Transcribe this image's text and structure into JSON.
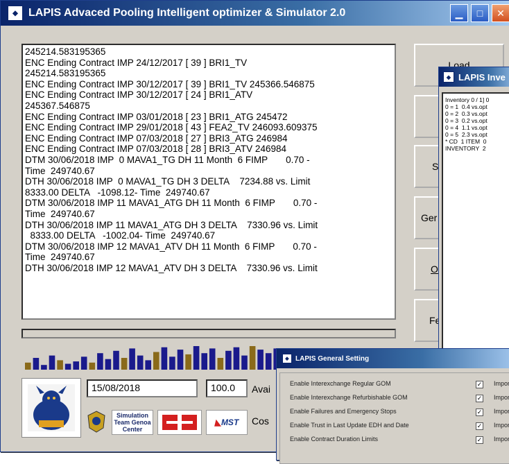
{
  "background": {
    "fragment": "t"
  },
  "main_window": {
    "title": "LAPIS Advaced Pooling Intelligent optimizer & Simulator 2.0",
    "app_icon": "lapis-app-icon",
    "log_lines": [
      "245214.583195365",
      "ENC Ending Contract IMP 24/12/2017 [ 39 ] BRI1_TV",
      "245214.583195365",
      "ENC Ending Contract IMP 30/12/2017 [ 39 ] BRI1_TV 245366.546875",
      "ENC Ending Contract IMP 30/12/2017 [ 24 ] BRI1_ATV",
      "245367.546875",
      "ENC Ending Contract IMP 03/01/2018 [ 23 ] BRI1_ATG 245472",
      "ENC Ending Contract IMP 29/01/2018 [ 43 ] FEA2_TV 246093.609375",
      "ENC Ending Contract IMP 07/03/2018 [ 27 ] BRI3_ATG 246984",
      "ENC Ending Contract IMP 07/03/2018 [ 28 ] BRI3_ATV 246984",
      "DTM 30/06/2018 IMP  0 MAVA1_TG DH 11 Month  6 FIMP       0.70 -",
      "Time  249740.67",
      "DTH 30/06/2018 IMP  0 MAVA1_TG DH 3 DELTA    7234.88 vs. Limit",
      "8333.00 DELTA   -1098.12- Time  249740.67",
      "DTM 30/06/2018 IMP 11 MAVA1_ATG DH 11 Month  6 FIMP       0.70 -",
      "Time  249740.67",
      "DTH 30/06/2018 IMP 11 MAVA1_ATG DH 3 DELTA    7330.96 vs. Limit",
      "  8333.00 DELTA   -1002.04- Time  249740.67",
      "DTM 30/06/2018 IMP 12 MAVA1_ATV DH 11 Month  6 FIMP       0.70 -",
      "Time  249740.67",
      "DTH 30/06/2018 IMP 12 MAVA1_ATV DH 3 DELTA    7330.96 vs. Limit"
    ],
    "side_buttons": [
      "Load",
      "",
      "S",
      "Ger",
      "O",
      "Fe"
    ],
    "date_value": "15/08/2018",
    "number_value": "100.0",
    "avail_label": "Avai",
    "cost_label": "Cos",
    "logos": {
      "simulation_team": "Simulation Team Genoa Center",
      "mst": "MST"
    },
    "bars_level": [
      0.3,
      0.5,
      0.2,
      0.6,
      0.4,
      0.25,
      0.35,
      0.55,
      0.3,
      0.7,
      0.45,
      0.8,
      0.5,
      0.9,
      0.6,
      0.4,
      0.75,
      0.95,
      0.55,
      0.85,
      0.65,
      1.0,
      0.7,
      0.9,
      0.5,
      0.8,
      0.95,
      0.6,
      1.0,
      0.85,
      0.7,
      0.9
    ]
  },
  "inventory_window": {
    "title": "LAPIS Inve",
    "lines": [
      "Inventory 0 / 1] 0",
      "0 = 1  0.4 vs.opt",
      "0 = 2  0.3 vs.opt",
      "0 = 3  0.2 vs.opt",
      "0 = 4  1.1 vs.opt",
      "0 = 5  2.3 vs.opt",
      "* CD  1 ITEM  0",
      "INVENTORY  2"
    ]
  },
  "settings_window": {
    "title": "LAPIS General Setting",
    "rows": [
      {
        "label": "Enable Interexchange Regular GOM",
        "checked": true,
        "import": "Import"
      },
      {
        "label": "Enable Interexchange Refurbishable GOM",
        "checked": true,
        "import": "Import"
      },
      {
        "label": "Enable Failures and Emergency Stops",
        "checked": true,
        "import": "Import"
      },
      {
        "label": "Enable Trust in Last Update EDH and Date",
        "checked": true,
        "import": "Import"
      },
      {
        "label": "Enable Contract Duration Limits",
        "checked": true,
        "import": "Import"
      }
    ],
    "check_glyph": "☑"
  },
  "colors": {
    "title_start": "#0a246a",
    "title_end": "#a6caf0",
    "bars": "#1a1a8c",
    "bars_alt": "#8a6a1a"
  }
}
